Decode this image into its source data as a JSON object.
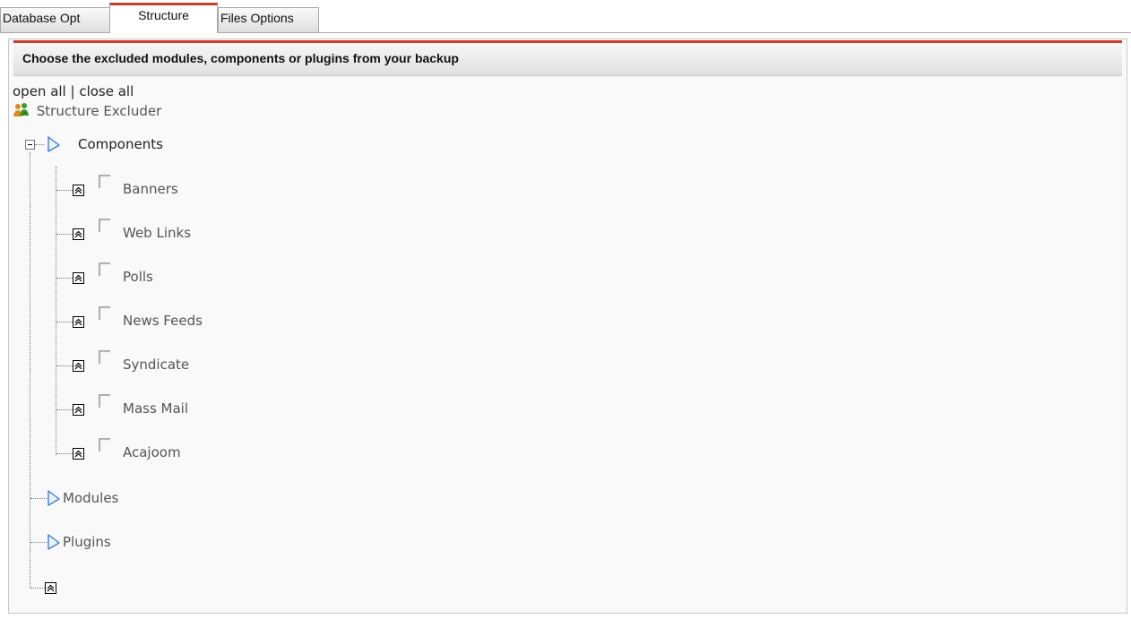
{
  "tabs": [
    {
      "label": "Database Opt",
      "active": false
    },
    {
      "label": "Structure",
      "active": true
    },
    {
      "label": "Files Options",
      "active": false
    }
  ],
  "panel": {
    "heading": "Choose the excluded modules, components or plugins from your backup"
  },
  "tree_controls": {
    "open_all": "open all",
    "separator": " | ",
    "close_all": "close all"
  },
  "tree": {
    "root_label": "Structure Excluder",
    "components": {
      "label": "Components",
      "items": [
        {
          "label": "Banners",
          "checked": false
        },
        {
          "label": "Web Links",
          "checked": false
        },
        {
          "label": "Polls",
          "checked": false
        },
        {
          "label": "News Feeds",
          "checked": false
        },
        {
          "label": "Syndicate",
          "checked": false
        },
        {
          "label": "Mass Mail",
          "checked": false
        },
        {
          "label": "Acajoom",
          "checked": false
        }
      ]
    },
    "modules": {
      "label": "Modules"
    },
    "plugins": {
      "label": "Plugins"
    }
  },
  "colors": {
    "accent": "#c8402a",
    "folder_icon": "#3d7fd6",
    "users_icon_green": "#3a9a2e",
    "users_icon_orange": "#e08a1a"
  },
  "icons": [
    "users-icon",
    "folder-triangle-icon",
    "collapse-minus-icon",
    "item-arrows-icon",
    "checkbox"
  ]
}
